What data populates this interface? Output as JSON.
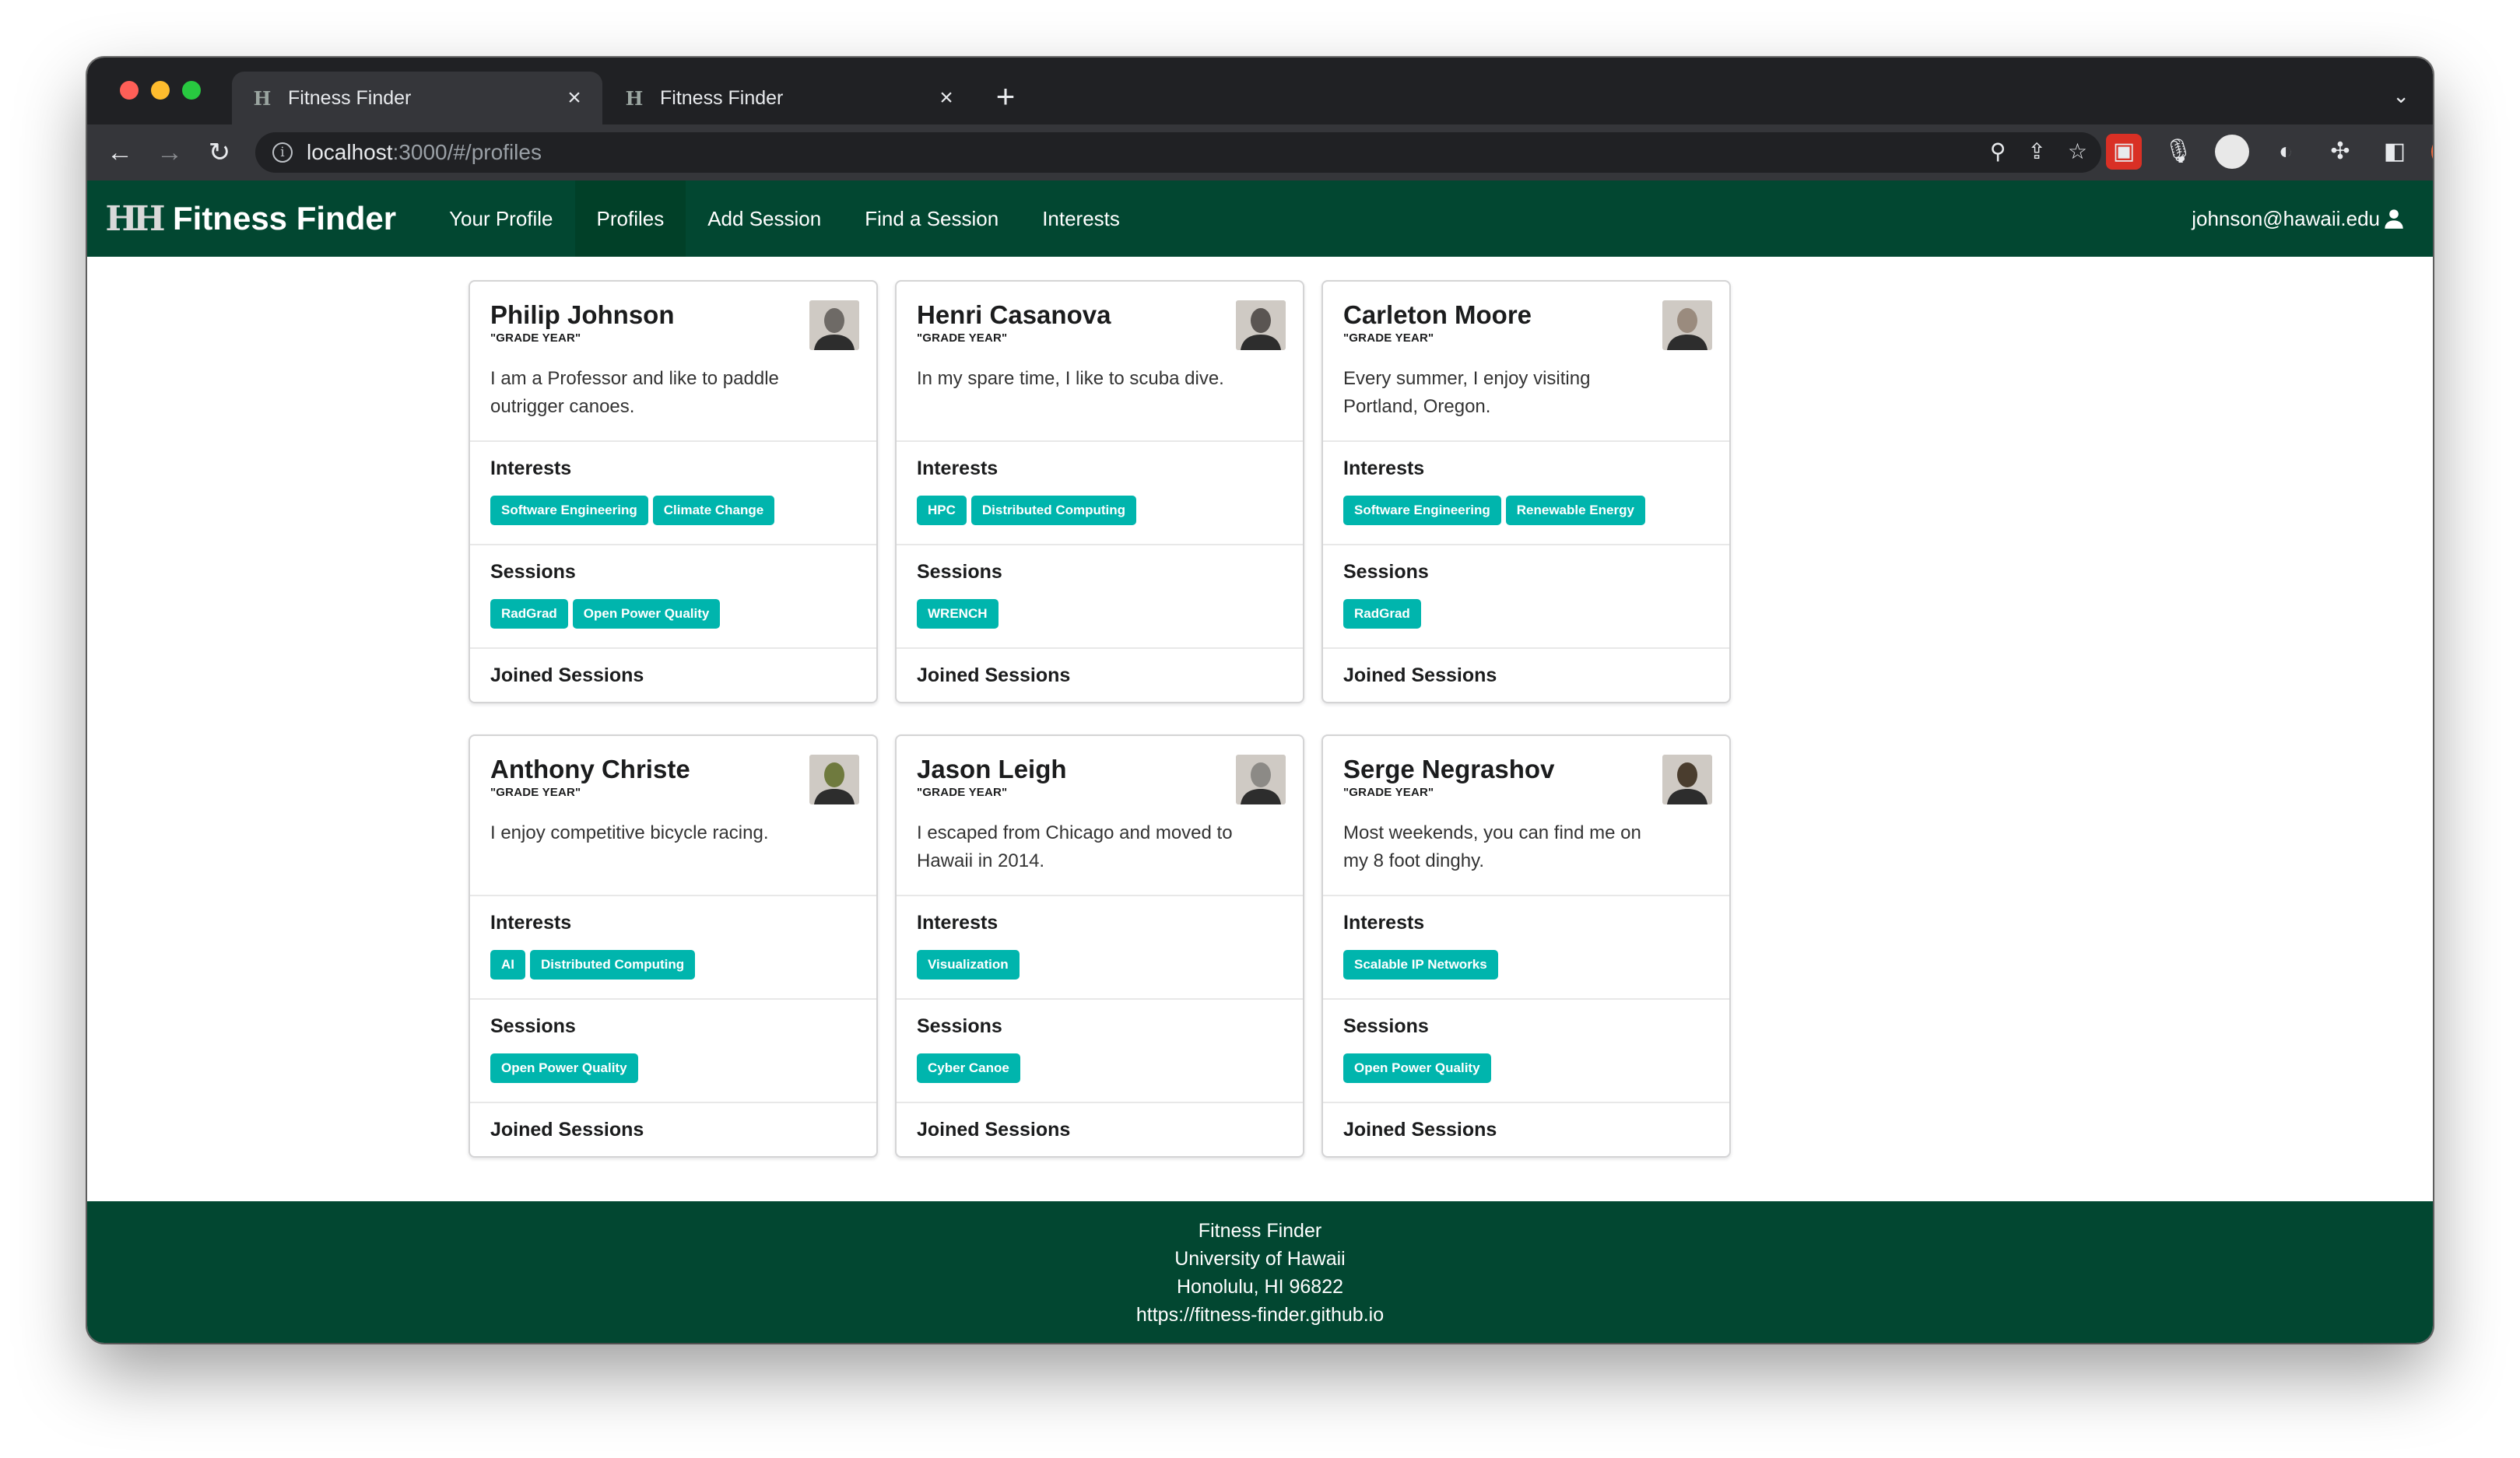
{
  "browser": {
    "tabs": [
      {
        "title": "Fitness Finder"
      },
      {
        "title": "Fitness Finder"
      }
    ],
    "url_host": "localhost",
    "url_rest": ":3000/#/profiles"
  },
  "navbar": {
    "brand": "Fitness Finder",
    "links": [
      "Your Profile",
      "Profiles",
      "Add Session",
      "Find a Session",
      "Interests"
    ],
    "user": "johnson@hawaii.edu"
  },
  "section_titles": {
    "interests": "Interests",
    "sessions": "Sessions",
    "joined": "Joined Sessions"
  },
  "profiles": [
    {
      "name": "Philip Johnson",
      "meta": "\"GRADE YEAR\"",
      "description": "I am a Professor and like to paddle outrigger canoes.",
      "interests": [
        "Software Engineering",
        "Climate Change"
      ],
      "sessions": [
        "RadGrad",
        "Open Power Quality"
      ],
      "avatar_color": "#6e6a66"
    },
    {
      "name": "Henri Casanova",
      "meta": "\"GRADE YEAR\"",
      "description": "In my spare time, I like to scuba dive.",
      "interests": [
        "HPC",
        "Distributed Computing"
      ],
      "sessions": [
        "WRENCH"
      ],
      "avatar_color": "#5a5552"
    },
    {
      "name": "Carleton Moore",
      "meta": "\"GRADE YEAR\"",
      "description": "Every summer, I enjoy visiting Portland, Oregon.",
      "interests": [
        "Software Engineering",
        "Renewable Energy"
      ],
      "sessions": [
        "RadGrad"
      ],
      "avatar_color": "#9a8b7e"
    },
    {
      "name": "Anthony Christe",
      "meta": "\"GRADE YEAR\"",
      "description": "I enjoy competitive bicycle racing.",
      "interests": [
        "AI",
        "Distributed Computing"
      ],
      "sessions": [
        "Open Power Quality"
      ],
      "avatar_color": "#6f7a3e"
    },
    {
      "name": "Jason Leigh",
      "meta": "\"GRADE YEAR\"",
      "description": "I escaped from Chicago and moved to Hawaii in 2014.",
      "interests": [
        "Visualization"
      ],
      "sessions": [
        "Cyber Canoe"
      ],
      "avatar_color": "#8c8a86"
    },
    {
      "name": "Serge Negrashov",
      "meta": "\"GRADE YEAR\"",
      "description": "Most weekends, you can find me on my 8 foot dinghy.",
      "interests": [
        "Scalable IP Networks"
      ],
      "sessions": [
        "Open Power Quality"
      ],
      "avatar_color": "#4a3d2e"
    }
  ],
  "footer": {
    "line1": "Fitness Finder",
    "line2": "University of Hawaii",
    "line3": "Honolulu, HI 96822",
    "line4": "https://fitness-finder.github.io"
  },
  "colors": {
    "brand_green": "#024731",
    "label_teal": "#00b5ad"
  }
}
